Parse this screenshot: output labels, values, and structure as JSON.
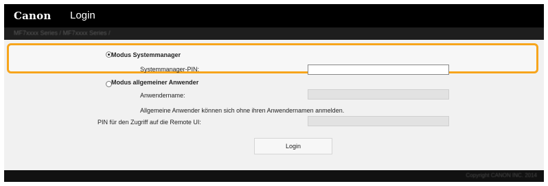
{
  "header": {
    "logo": "Canon",
    "title": "Login"
  },
  "subbar": {
    "text": "MF7xxxx Series / MF7xxxx Series /"
  },
  "form": {
    "mode_admin_label": "Modus Systemmanager",
    "admin_pin_label": "Systemmanager-PIN:",
    "admin_pin_value": "",
    "mode_general_label": "Modus allgemeiner Anwender",
    "username_label": "Anwendername:",
    "username_value": "",
    "info_text": "Allgemeine Anwender können sich ohne ihren Anwendernamen anmelden.",
    "remote_pin_label": "PIN für den Zugriff auf die Remote UI:",
    "remote_pin_value": "",
    "login_button": "Login"
  },
  "footer": {
    "copyright": "Copyright CANON INC. 2014"
  },
  "colors": {
    "highlight": "#f7a51c",
    "topbar": "#000000",
    "content_bg": "#f1f1f1"
  }
}
